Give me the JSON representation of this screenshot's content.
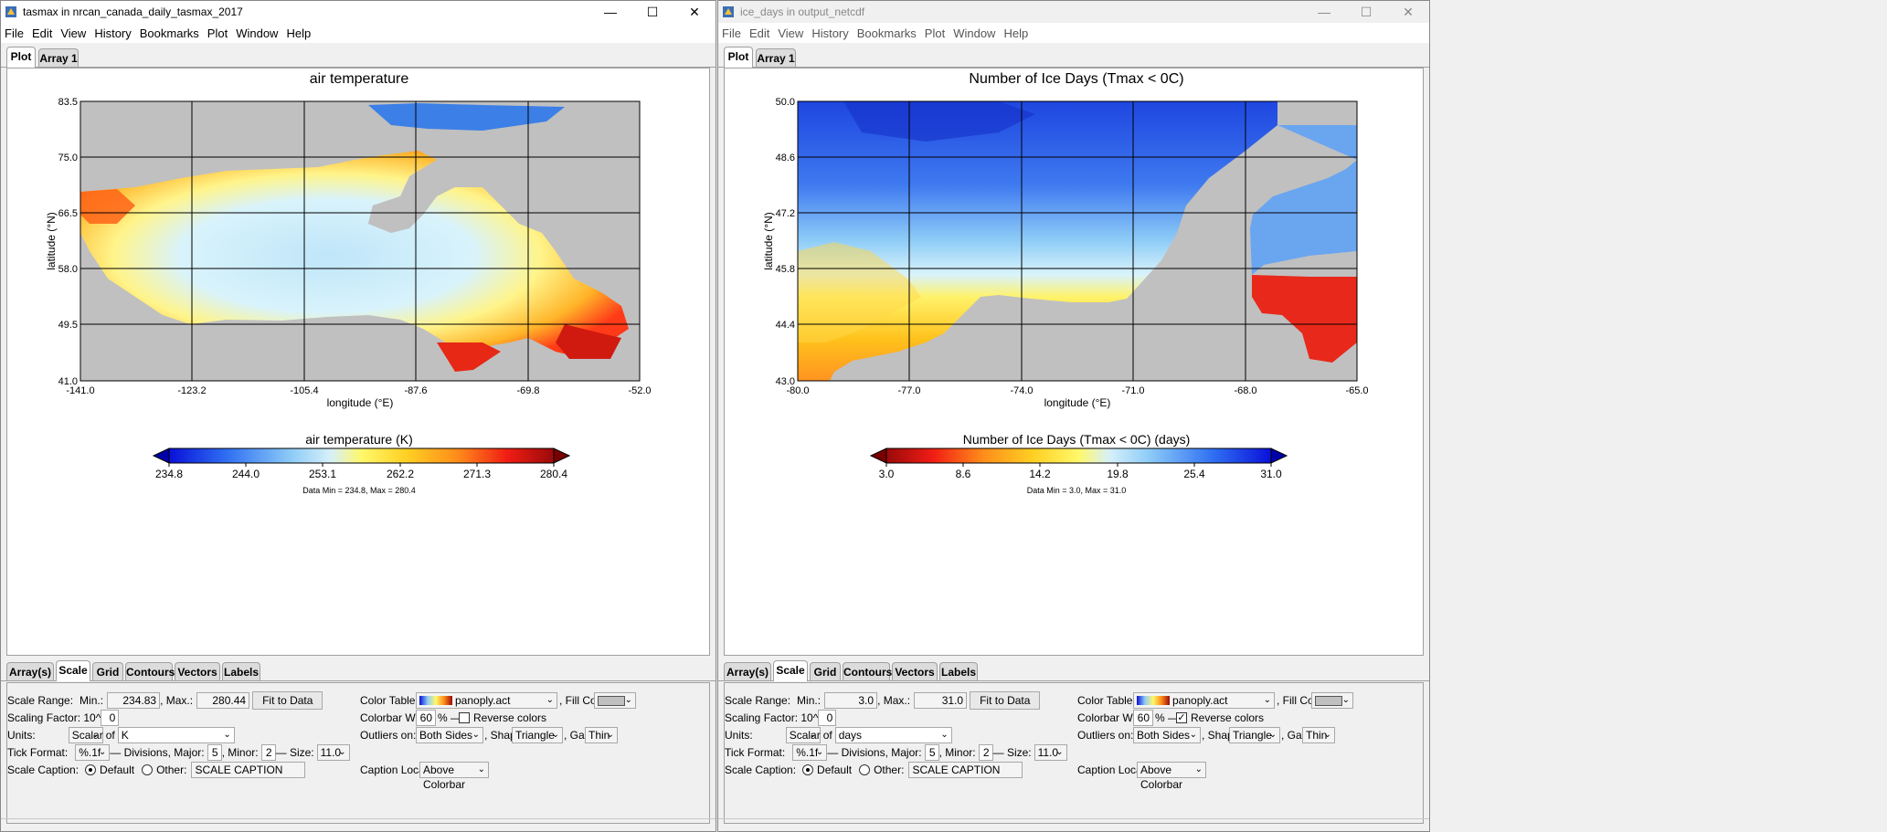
{
  "menu": [
    "File",
    "Edit",
    "View",
    "History",
    "Bookmarks",
    "Plot",
    "Window",
    "Help"
  ],
  "windows": [
    {
      "id": "w1",
      "title": "tasmax in nrcan_canada_daily_tasmax_2017",
      "tabs": [
        "Plot",
        "Array 1"
      ],
      "plot": {
        "title": "air temperature",
        "xlabel": "longitude (°E)",
        "ylabel": "latitude (°N)",
        "xticks": [
          "-141.0",
          "-123.2",
          "-105.4",
          "-87.6",
          "-69.8",
          "-52.0"
        ],
        "yticks": [
          "83.5",
          "75.0",
          "66.5",
          "58.0",
          "49.5",
          "41.0"
        ],
        "colorbar_title": "air temperature (K)",
        "colorbar_ticks": [
          "234.8",
          "244.0",
          "253.1",
          "262.2",
          "271.3",
          "280.4"
        ],
        "colorbar_reversed": false,
        "datarange": "Data Min = 234.8, Max = 280.4"
      },
      "ctrl_tabs": [
        "Array(s)",
        "Scale",
        "Grid",
        "Contours",
        "Vectors",
        "Labels"
      ],
      "scale": {
        "range_label": "Scale Range:",
        "min_label": "Min.:",
        "min": "234.83",
        "max_label": ", Max.:",
        "max": "280.44",
        "fit_button": "Fit to Data",
        "factor_label": "Scaling Factor: 10^",
        "factor": "0",
        "units_label": "Units:",
        "units_type": "Scalar",
        "of_label": "of",
        "units": "K",
        "tick_label": "Tick Format:",
        "tick_format": "%.1f",
        "divisions_label": "— Divisions, Major:",
        "major": "5",
        "minor_label": ", Minor:",
        "minor": "2",
        "size_label": "— Size:",
        "size": "11.0",
        "caption_label": "Scale Caption:",
        "default_label": "Default",
        "other_label": "Other:",
        "caption": "SCALE CAPTION",
        "color_table_label": "Color Table:",
        "color_table": "panoply.act",
        "fill_label": ", Fill Color:",
        "cb_width_label": "Colorbar Width:",
        "cb_width": "60",
        "percent_label": "% —",
        "reverse_label": "Reverse colors",
        "reverse_checked": false,
        "outliers_label": "Outliers on:",
        "outliers": "Both Sides",
        "shape_label": ", Shape:",
        "shape": "Triangle",
        "gap_label": ", Gap:",
        "gap": "Thin",
        "caption_loc_label": "Caption Location:",
        "caption_loc": "Above Colorbar"
      }
    },
    {
      "id": "w2",
      "title": "ice_days in output_netcdf",
      "tabs": [
        "Plot",
        "Array 1"
      ],
      "plot": {
        "title": "Number of Ice Days (Tmax < 0C)",
        "xlabel": "longitude (°E)",
        "ylabel": "latitude (°N)",
        "xticks": [
          "-80.0",
          "-77.0",
          "-74.0",
          "-71.0",
          "-68.0",
          "-65.0"
        ],
        "yticks": [
          "50.0",
          "48.6",
          "47.2",
          "45.8",
          "44.4",
          "43.0"
        ],
        "colorbar_title": "Number of Ice Days (Tmax < 0C) (days)",
        "colorbar_ticks": [
          "3.0",
          "8.6",
          "14.2",
          "19.8",
          "25.4",
          "31.0"
        ],
        "colorbar_reversed": true,
        "datarange": "Data Min = 3.0, Max = 31.0"
      },
      "ctrl_tabs": [
        "Array(s)",
        "Scale",
        "Grid",
        "Contours",
        "Vectors",
        "Labels"
      ],
      "scale": {
        "range_label": "Scale Range:",
        "min_label": "Min.:",
        "min": "3.0",
        "max_label": ", Max.:",
        "max": "31.0",
        "fit_button": "Fit to Data",
        "factor_label": "Scaling Factor: 10^",
        "factor": "0",
        "units_label": "Units:",
        "units_type": "Scalar",
        "of_label": "of",
        "units": "days",
        "tick_label": "Tick Format:",
        "tick_format": "%.1f",
        "divisions_label": "— Divisions, Major:",
        "major": "5",
        "minor_label": ", Minor:",
        "minor": "2",
        "size_label": "— Size:",
        "size": "11.0",
        "caption_label": "Scale Caption:",
        "default_label": "Default",
        "other_label": "Other:",
        "caption": "SCALE CAPTION",
        "color_table_label": "Color Table:",
        "color_table": "panoply.act",
        "fill_label": ", Fill Color:",
        "cb_width_label": "Colorbar Width:",
        "cb_width": "60",
        "percent_label": "% —",
        "reverse_label": "Reverse colors",
        "reverse_checked": true,
        "outliers_label": "Outliers on:",
        "outliers": "Both Sides",
        "shape_label": ", Shape:",
        "shape": "Triangle",
        "gap_label": ", Gap:",
        "gap": "Thin",
        "caption_loc_label": "Caption Location:",
        "caption_loc": "Above Colorbar"
      }
    }
  ]
}
